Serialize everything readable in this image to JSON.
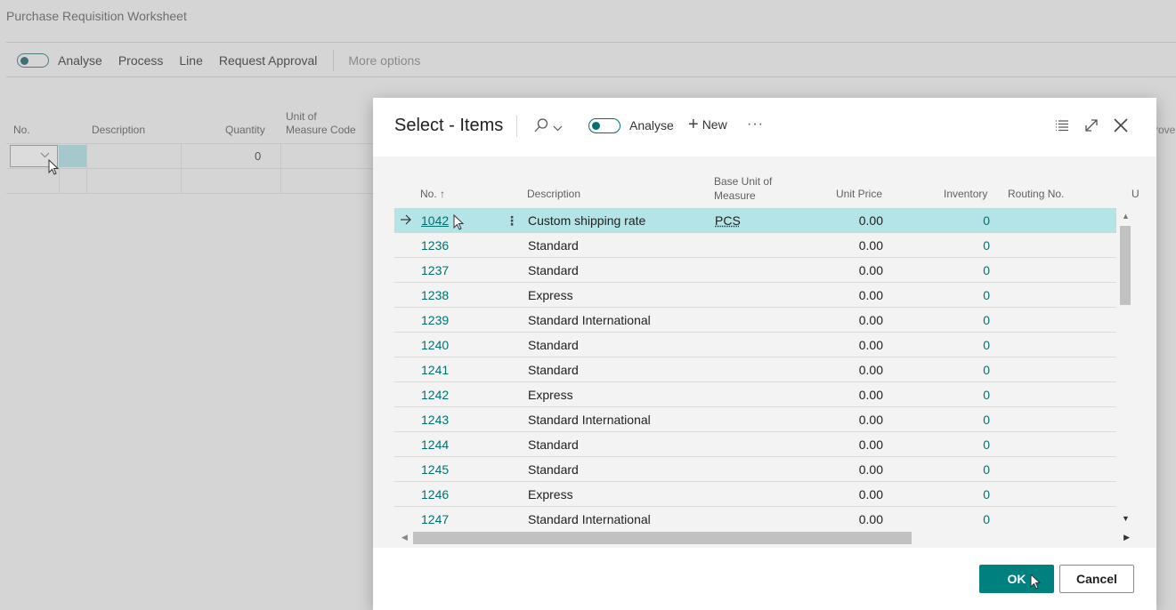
{
  "background_page": {
    "title": "Purchase Requisition Worksheet",
    "toolbar": {
      "analyse_label": "Analyse",
      "actions": [
        "Process",
        "Line",
        "Request Approval"
      ],
      "more_options_label": "More options"
    },
    "columns": {
      "no": "No.",
      "description": "Description",
      "quantity": "Quantity",
      "unit_of_measure_line1": "Unit of",
      "unit_of_measure_line2": "Measure Code",
      "truncated": "rove"
    },
    "first_row_quantity": "0"
  },
  "dialog": {
    "title": "Select - Items",
    "analyse_label": "Analyse",
    "new_label": "New",
    "more_glyph": "···",
    "columns": {
      "no": "No. ↑",
      "description": "Description",
      "base_unit_line1": "Base Unit of",
      "base_unit_line2": "Measure",
      "unit_price": "Unit Price",
      "inventory": "Inventory",
      "routing_no": "Routing No.",
      "truncated": "U"
    },
    "rows": [
      {
        "no": "1042",
        "description": "Custom shipping rate",
        "base_unit": "PCS",
        "unit_price": "0.00",
        "inventory": "0",
        "selected": true
      },
      {
        "no": "1236",
        "description": "Standard",
        "base_unit": "",
        "unit_price": "0.00",
        "inventory": "0"
      },
      {
        "no": "1237",
        "description": "Standard",
        "base_unit": "",
        "unit_price": "0.00",
        "inventory": "0"
      },
      {
        "no": "1238",
        "description": "Express",
        "base_unit": "",
        "unit_price": "0.00",
        "inventory": "0"
      },
      {
        "no": "1239",
        "description": "Standard International",
        "base_unit": "",
        "unit_price": "0.00",
        "inventory": "0"
      },
      {
        "no": "1240",
        "description": "Standard",
        "base_unit": "",
        "unit_price": "0.00",
        "inventory": "0"
      },
      {
        "no": "1241",
        "description": "Standard",
        "base_unit": "",
        "unit_price": "0.00",
        "inventory": "0"
      },
      {
        "no": "1242",
        "description": "Express",
        "base_unit": "",
        "unit_price": "0.00",
        "inventory": "0"
      },
      {
        "no": "1243",
        "description": "Standard International",
        "base_unit": "",
        "unit_price": "0.00",
        "inventory": "0"
      },
      {
        "no": "1244",
        "description": "Standard",
        "base_unit": "",
        "unit_price": "0.00",
        "inventory": "0"
      },
      {
        "no": "1245",
        "description": "Standard",
        "base_unit": "",
        "unit_price": "0.00",
        "inventory": "0"
      },
      {
        "no": "1246",
        "description": "Express",
        "base_unit": "",
        "unit_price": "0.00",
        "inventory": "0"
      },
      {
        "no": "1247",
        "description": "Standard International",
        "base_unit": "",
        "unit_price": "0.00",
        "inventory": "0"
      }
    ],
    "ok_label": "OK",
    "cancel_label": "Cancel"
  },
  "colors": {
    "accent": "#00807e",
    "selected_row": "#b4e4e8",
    "link": "#00706f"
  },
  "icons": [
    "search-icon",
    "chevron-down-icon",
    "list-view-icon",
    "expand-icon",
    "close-icon",
    "row-arrow-icon",
    "row-menu-icon",
    "cursor-icon"
  ]
}
